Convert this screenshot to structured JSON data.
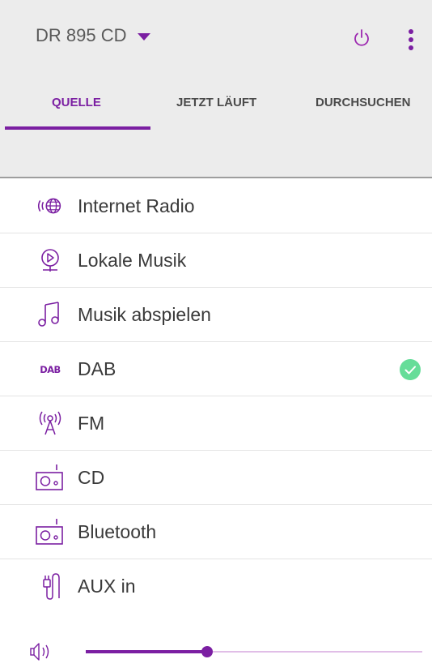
{
  "header": {
    "device_name": "DR 895 CD",
    "icons": {
      "dropdown": "caret-down-icon",
      "power": "power-icon",
      "more": "more-vert-icon"
    }
  },
  "tabs": [
    {
      "label": "QUELLE",
      "active": true
    },
    {
      "label": "JETZT LÄUFT",
      "active": false
    },
    {
      "label": "DURCHSUCHEN",
      "active": false
    }
  ],
  "sources": [
    {
      "label": "Internet Radio",
      "icon": "internet-radio-icon",
      "selected": false
    },
    {
      "label": "Lokale Musik",
      "icon": "local-music-icon",
      "selected": false
    },
    {
      "label": "Musik abspielen",
      "icon": "music-note-icon",
      "selected": false
    },
    {
      "label": "DAB",
      "icon": "dab-icon",
      "selected": true
    },
    {
      "label": "FM",
      "icon": "fm-antenna-icon",
      "selected": false
    },
    {
      "label": "CD",
      "icon": "cd-radio-icon",
      "selected": false
    },
    {
      "label": "Bluetooth",
      "icon": "bluetooth-radio-icon",
      "selected": false
    },
    {
      "label": "AUX in",
      "icon": "aux-plug-icon",
      "selected": false
    }
  ],
  "volume": {
    "icon": "volume-icon",
    "level": 0.36
  },
  "colors": {
    "accent": "#7b1fa2",
    "selected_check": "#66dd99",
    "header_bg": "#ececec"
  }
}
